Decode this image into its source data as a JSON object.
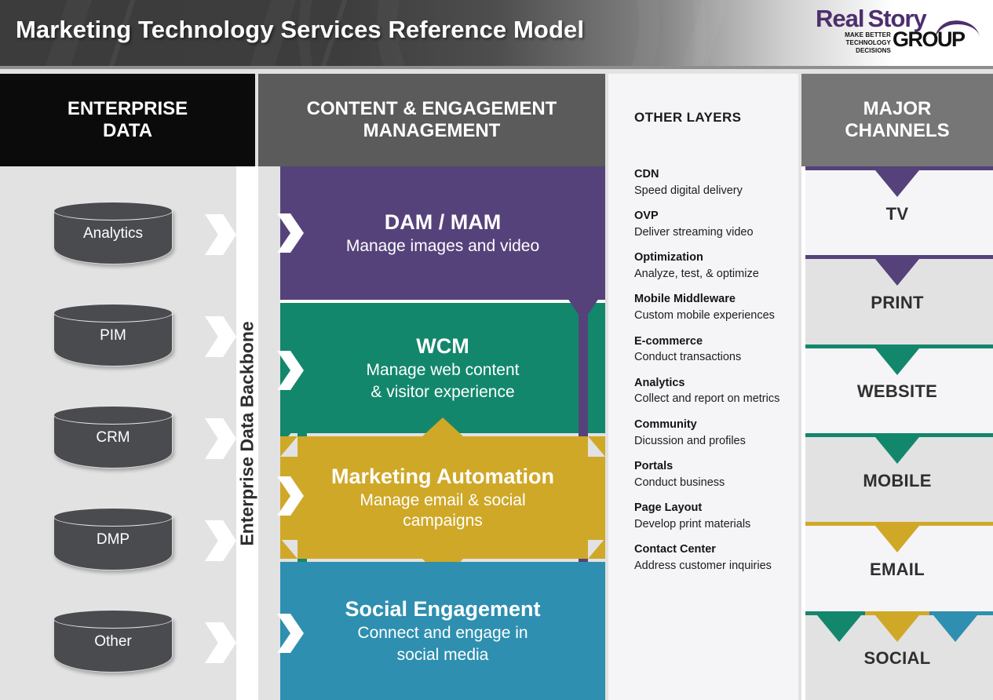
{
  "header": {
    "title": "Marketing Technology Services Reference Model",
    "logo": {
      "word1": "Real",
      "word2": "Story",
      "word3": "GROUP",
      "tagline_line1": "MAKE BETTER",
      "tagline_line2": "TECHNOLOGY DECISIONS"
    }
  },
  "bands": {
    "enterprise_data": "ENTERPRISE\nDATA",
    "enterprise_data_line1": "ENTERPRISE",
    "enterprise_data_line2": "DATA",
    "content_engagement_line1": "CONTENT & ENGAGEMENT",
    "content_engagement_line2": "MANAGEMENT",
    "other_layers": "OTHER LAYERS",
    "major_channels_line1": "MAJOR",
    "major_channels_line2": "CHANNELS"
  },
  "enterprise_data": {
    "backbone_label": "Enterprise Data Backbone",
    "stores": [
      {
        "label": "Analytics"
      },
      {
        "label": "PIM"
      },
      {
        "label": "CRM"
      },
      {
        "label": "DMP"
      },
      {
        "label": "Other"
      }
    ]
  },
  "center_blocks": [
    {
      "title": "DAM / MAM",
      "subtitle_line1": "Manage images and video",
      "subtitle_line2": "",
      "color": "#55427a"
    },
    {
      "title": "WCM",
      "subtitle_line1": "Manage web content",
      "subtitle_line2": "& visitor experience",
      "color": "#13876c"
    },
    {
      "title": "Marketing Automation",
      "subtitle_line1": "Manage email & social",
      "subtitle_line2": "campaigns",
      "color": "#cfa828"
    },
    {
      "title": "Social Engagement",
      "subtitle_line1": "Connect and engage in",
      "subtitle_line2": "social media",
      "color": "#2e8fb0"
    }
  ],
  "other_layers": [
    {
      "name": "CDN",
      "desc": "Speed digital delivery"
    },
    {
      "name": "OVP",
      "desc": "Deliver streaming video"
    },
    {
      "name": "Optimization",
      "desc": "Analyze, test, & optimize"
    },
    {
      "name": "Mobile Middleware",
      "desc": "Custom mobile experiences"
    },
    {
      "name": "E-commerce",
      "desc": "Conduct transactions"
    },
    {
      "name": "Analytics",
      "desc": "Collect and report on metrics"
    },
    {
      "name": "Community",
      "desc": "Dicussion and profiles"
    },
    {
      "name": "Portals",
      "desc": "Conduct business"
    },
    {
      "name": "Page Layout",
      "desc": "Develop print materials"
    },
    {
      "name": "Contact Center",
      "desc": "Address customer inquiries"
    }
  ],
  "channels": [
    {
      "label": "TV",
      "accent": "#55427a",
      "accents": [
        "#55427a"
      ]
    },
    {
      "label": "PRINT",
      "accent": "#55427a",
      "accents": [
        "#55427a"
      ]
    },
    {
      "label": "WEBSITE",
      "accent": "#13876c",
      "accents": [
        "#13876c"
      ]
    },
    {
      "label": "MOBILE",
      "accent": "#13876c",
      "accents": [
        "#13876c"
      ]
    },
    {
      "label": "EMAIL",
      "accent": "#cfa828",
      "accents": [
        "#cfa828"
      ]
    },
    {
      "label": "SOCIAL",
      "accent": "#13876c",
      "accents": [
        "#13876c",
        "#cfa828",
        "#2e8fb0"
      ]
    }
  ],
  "colors": {
    "purple": "#55427a",
    "teal": "#13876c",
    "gold": "#cfa828",
    "blue": "#2e8fb0",
    "dark_band": "#0b0b0b",
    "gray_band": "#5b5b5b",
    "channel_band": "#767676",
    "panel_gray": "#e2e2e2",
    "panel_light": "#f5f5f7"
  }
}
